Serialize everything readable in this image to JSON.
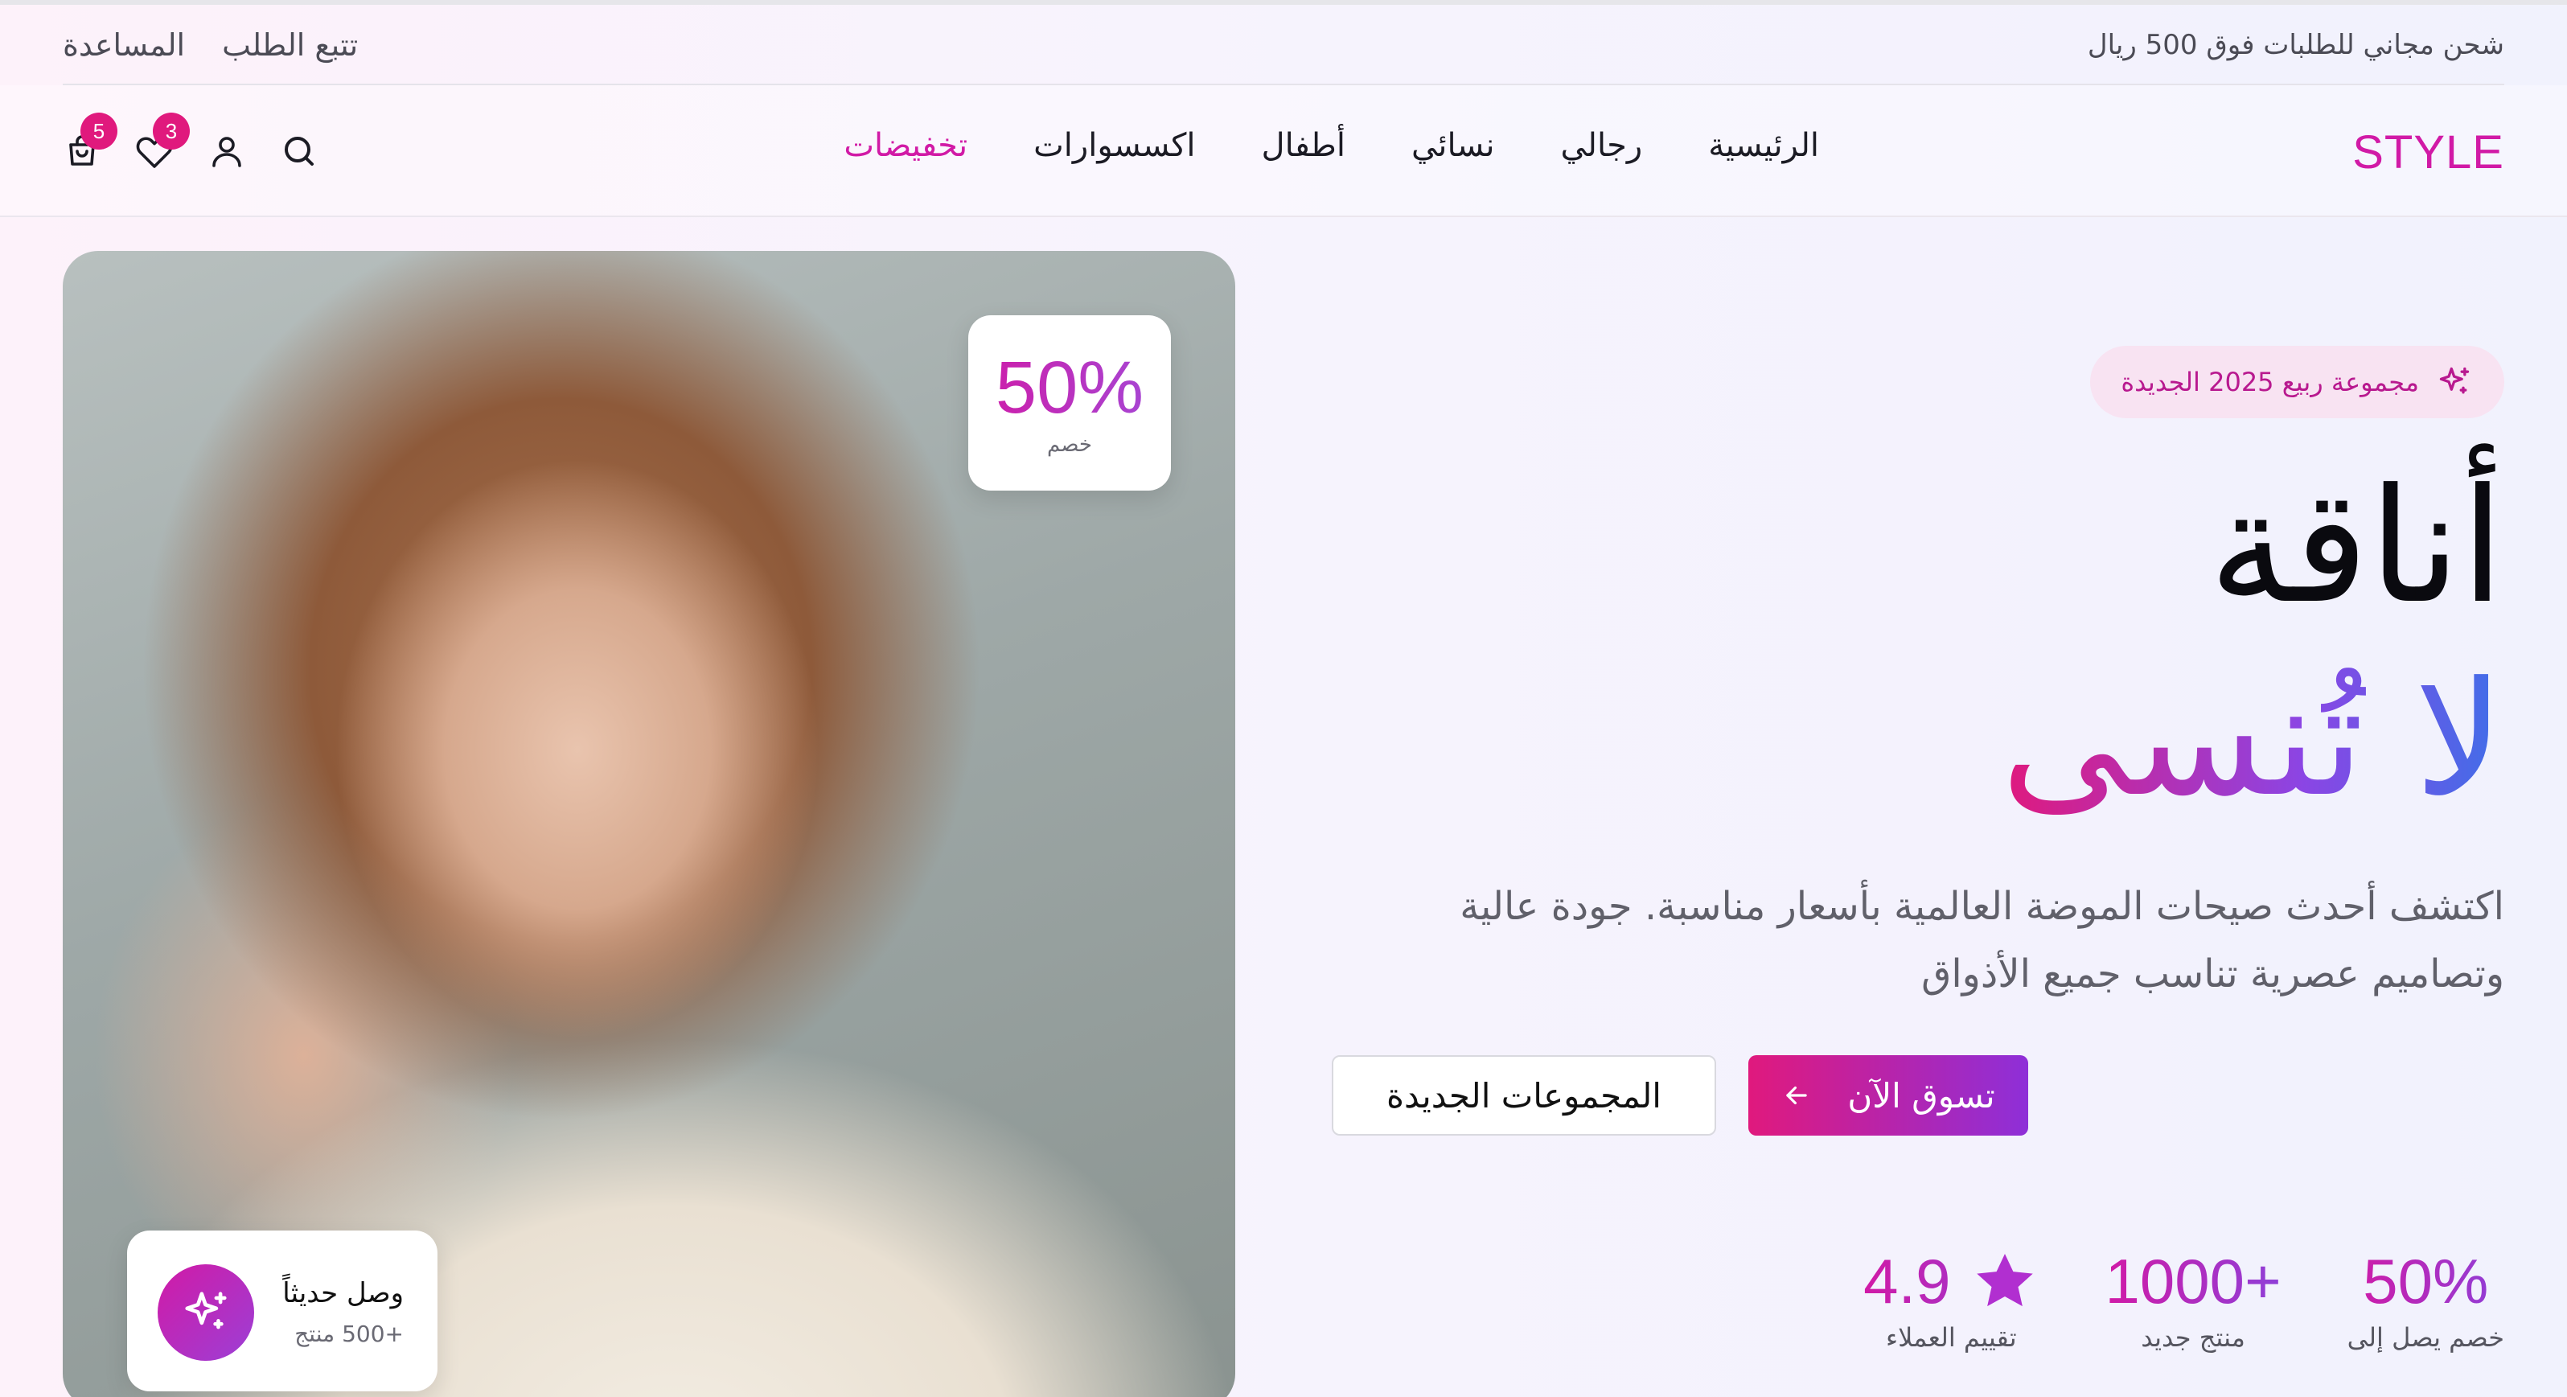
{
  "topbar": {
    "promo": "شحن مجاني للطلبات فوق 500 ريال",
    "track_order": "تتبع الطلب",
    "help": "المساعدة"
  },
  "nav": {
    "logo": "STYLE",
    "links": [
      "الرئيسية",
      "رجالي",
      "نسائي",
      "أطفال",
      "اكسسوارات",
      "تخفيضات"
    ],
    "wishlist_count": "3",
    "cart_count": "5"
  },
  "hero": {
    "badge": "مجموعة ربيع 2025 الجديدة",
    "title_line1": "أناقة",
    "title_line2": "لا تُنسى",
    "description": "اكتشف أحدث صيحات الموضة العالمية بأسعار مناسبة. جودة عالية وتصاميم عصرية تناسب جميع الأذواق",
    "cta_primary": "تسوق الآن",
    "cta_secondary": "المجموعات الجديدة",
    "discount_value": "50%",
    "discount_label": "خصم",
    "arrival_title": "وصل حديثاً",
    "arrival_subtitle": "+500 منتج"
  },
  "stats": [
    {
      "value": "50%",
      "label": "خصم يصل إلى"
    },
    {
      "value": "1000+",
      "label": "منتج جديد"
    },
    {
      "value": "4.9",
      "label": "تقييم العملاء"
    }
  ],
  "colors": {
    "brand": "#d11aa6",
    "badge": "#e0197d",
    "accent_purple": "#8e2fd8",
    "accent_blue": "#3f6fe8"
  },
  "icons": [
    "search-icon",
    "user-icon",
    "heart-icon",
    "bag-icon",
    "sparkles-icon",
    "arrow-left-icon",
    "star-icon"
  ]
}
